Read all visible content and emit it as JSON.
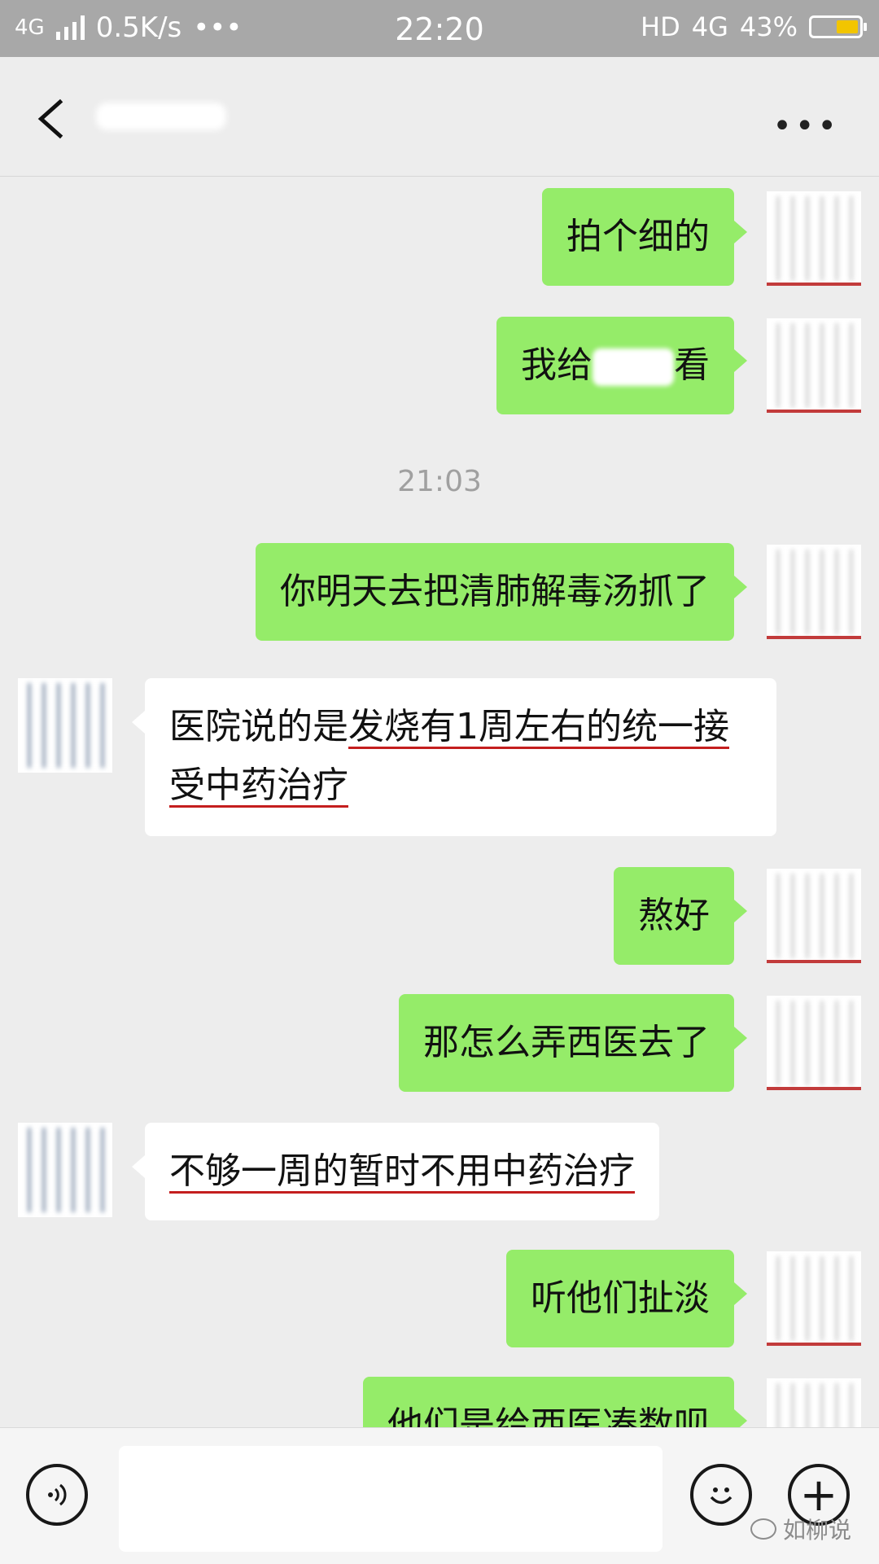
{
  "status_bar": {
    "network": "4G",
    "speed": "0.5K/s",
    "dots": "•••",
    "time": "22:20",
    "hd": "HD",
    "net_right": "4G",
    "battery": "43%",
    "colors": {
      "battery_fill": "#f2c500"
    }
  },
  "nav": {
    "back_icon": "chevron-left-icon",
    "more_icon": "more-dots-icon",
    "more": "•••"
  },
  "messages": [
    {
      "side": "me",
      "text": "拍个细的"
    },
    {
      "side": "me",
      "text_before": "我给",
      "text_after": "看"
    },
    {
      "type": "time",
      "text": "21:03"
    },
    {
      "side": "me",
      "text": "你明天去把清肺解毒汤抓了"
    },
    {
      "side": "them",
      "text_plain": "医院说的是",
      "text_underlined": "发烧有1周左右的统一接受中药治疗"
    },
    {
      "side": "me",
      "text": "熬好"
    },
    {
      "side": "me",
      "text": "那怎么弄西医去了"
    },
    {
      "side": "them",
      "text_underlined": "不够一周的暂时不用中药治疗"
    },
    {
      "side": "me",
      "text": "听他们扯淡"
    },
    {
      "side": "me",
      "text": "他们是给西医凑数呗"
    }
  ],
  "input_bar": {
    "voice_icon": "voice-icon",
    "emoji_icon": "emoji-icon",
    "plus_icon": "plus-icon",
    "plus": "+",
    "watermark": "如柳说"
  },
  "colors": {
    "my_bubble": "#95ec69",
    "their_bubble": "#ffffff",
    "background": "#ededed",
    "underline": "#c41e1e"
  }
}
